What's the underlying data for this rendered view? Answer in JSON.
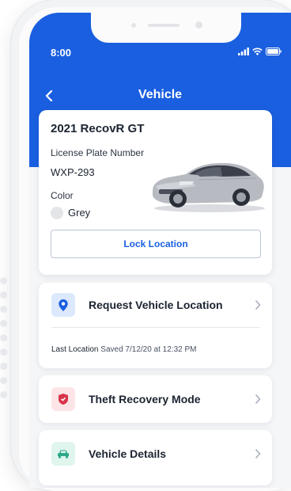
{
  "status_bar": {
    "time": "8:00"
  },
  "header": {
    "title": "Vehicle"
  },
  "vehicle": {
    "name": "2021 RecovR GT",
    "plate_label": "License Plate Number",
    "plate_value": "WXP-293",
    "color_label": "Color",
    "color_value": "Grey",
    "color_swatch": "#e4e5e8"
  },
  "lock_button": {
    "label": "Lock Location"
  },
  "actions": [
    {
      "label": "Request Vehicle Location",
      "icon": "location-pin-icon"
    },
    {
      "label": "Theft Recovery Mode",
      "icon": "shield-icon"
    },
    {
      "label": "Vehicle Details",
      "icon": "car-icon"
    }
  ],
  "last_location": {
    "label": "Last Location",
    "value": "Saved 7/12/20 at 12:32 PM"
  },
  "colors": {
    "brand": "#1a5fe0",
    "shield_bg": "#fde4e6",
    "shield": "#d8344a",
    "car_bg": "#dff5ee",
    "car": "#2ea98a",
    "pin_bg": "#dce9fc"
  }
}
